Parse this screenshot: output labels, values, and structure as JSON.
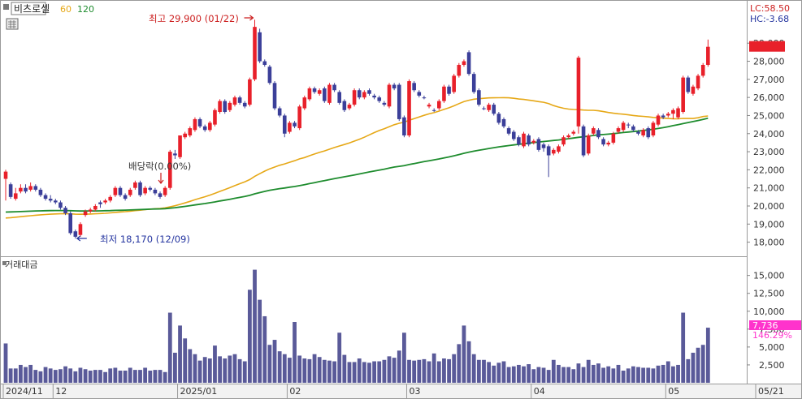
{
  "header": {
    "title": "비츠로셀",
    "ma_labels": [
      "60",
      "120"
    ],
    "ma_colors": [
      "#e6a817",
      "#1e8c2e"
    ],
    "chart_icon": "grid-icon",
    "lc_label": "LC:58.50",
    "hc_label": "HC:-3.68"
  },
  "annotations": {
    "high": "최고 29,900 (01/22)",
    "low": "최저 18,170 (12/09)",
    "dividend": "배당락(0.00%)"
  },
  "price_panel": {
    "current_price": "28,800",
    "change_pct": "3.78%"
  },
  "volume_panel": {
    "title": "거래대금",
    "current_value": "7,736",
    "change_pct": "146.29%"
  },
  "chart_data": {
    "type": "candlestick",
    "title": "비츠로셀",
    "x_ticks": [
      {
        "label": "2024/11",
        "index": 0
      },
      {
        "label": "12",
        "index": 10
      },
      {
        "label": "2025/01",
        "index": 35
      },
      {
        "label": "02",
        "index": 57
      },
      {
        "label": "03",
        "index": 81
      },
      {
        "label": "04",
        "index": 106
      },
      {
        "label": "05",
        "index": 133
      },
      {
        "label": "05/21",
        "index": 152
      }
    ],
    "price_axis": {
      "ylim": [
        17400,
        30400
      ],
      "ticks": [
        18000,
        19000,
        20000,
        21000,
        22000,
        23000,
        24000,
        25000,
        26000,
        27000,
        28000,
        29000
      ]
    },
    "volume_axis": {
      "ylim": [
        0,
        17000
      ],
      "ticks": [
        2500,
        5000,
        7500,
        10000,
        12500,
        15000
      ]
    },
    "price_tick_labels": [
      "18,000",
      "19,000",
      "20,000",
      "21,000",
      "22,000",
      "23,000",
      "24,000",
      "25,000",
      "26,000",
      "27,000",
      "28,000",
      "29,000"
    ],
    "volume_tick_labels": [
      "2,500",
      "5,000",
      "7,500",
      "10,000",
      "12,500",
      "15,000"
    ],
    "up_color": "#e8202a",
    "down_color": "#3b3f99",
    "volume_color": "#5a5a99",
    "ma60_color": "#e6a817",
    "ma120_color": "#1e8c2e",
    "closes": [
      21500,
      20500,
      20700,
      21000,
      20800,
      21100,
      20900,
      20600,
      20400,
      20300,
      20200,
      19900,
      19600,
      18500,
      18300,
      19000,
      19700,
      19800,
      20000,
      20100,
      20300,
      20500,
      21000,
      20600,
      20400,
      20900,
      21300,
      20600,
      21000,
      20900,
      20700,
      20500,
      21000,
      23000,
      22800,
      23900,
      24000,
      24300,
      24800,
      24400,
      24200,
      24600,
      25300,
      25800,
      25200,
      25700,
      26000,
      25700,
      25500,
      27000,
      29900,
      28000,
      27800,
      26800,
      25400,
      25000,
      24000,
      24600,
      24400,
      25500,
      26000,
      26500,
      26300,
      26400,
      25800,
      26700,
      26400,
      25700,
      25300,
      25600,
      26400,
      26000,
      26300,
      26200,
      26000,
      25800,
      25600,
      26700,
      26500,
      24800,
      23900,
      26900,
      26400,
      26100,
      26000,
      25600,
      25300,
      25800,
      26600,
      26200,
      27200,
      27800,
      28000,
      27300,
      26300,
      25600,
      25400,
      25600,
      25100,
      24600,
      24400,
      24000,
      23700,
      23400,
      24000,
      23400,
      23600,
      23100,
      23200,
      22800,
      23100,
      23300,
      23800,
      23900,
      24100,
      24400,
      22800,
      23900,
      24300,
      23800,
      23400,
      23500,
      24000,
      24300,
      24600,
      24500,
      24200,
      24000,
      24200,
      23800,
      24600,
      25000,
      24900,
      25100,
      25300,
      25400,
      27100,
      26300,
      26600,
      27200,
      27800,
      28800
    ],
    "up_days": [
      0,
      3,
      5,
      15,
      17,
      18,
      20,
      21,
      22,
      25,
      26,
      28,
      33,
      35,
      37,
      38,
      41,
      42,
      43,
      45,
      46,
      49,
      50,
      57,
      59,
      60,
      61,
      63,
      65,
      69,
      70,
      72,
      77,
      81,
      85,
      88,
      90,
      91,
      92,
      97,
      104,
      106,
      110,
      111,
      112,
      113,
      114,
      115,
      117,
      118,
      122,
      123,
      124,
      128,
      130,
      131,
      133,
      136,
      138,
      139,
      140,
      141
    ],
    "opens": [
      21900,
      21200,
      20400,
      20800,
      21000,
      20900,
      21100,
      20900,
      20600,
      20400,
      20300,
      20200,
      19900,
      19600,
      18600,
      18400,
      19500,
      19700,
      19800,
      20200,
      20200,
      20300,
      20600,
      21000,
      20600,
      20600,
      21000,
      21300,
      20700,
      21000,
      20900,
      20700,
      20600,
      21000,
      22900,
      22700,
      23800,
      23900,
      24200,
      24800,
      24400,
      24200,
      24500,
      25200,
      25800,
      25300,
      25600,
      26000,
      25700,
      25600,
      27000,
      29600,
      28000,
      27700,
      26800,
      25400,
      25000,
      24100,
      24600,
      24300,
      25400,
      25900,
      26500,
      26200,
      26500,
      25700,
      26700,
      26300,
      25800,
      25400,
      25600,
      26400,
      26000,
      26400,
      26100,
      26000,
      25700,
      25500,
      26700,
      26700,
      24900,
      23900,
      26800,
      26300,
      26000,
      25500,
      25300,
      25400,
      25800,
      26600,
      26300,
      27200,
      27800,
      28500,
      27300,
      26400,
      25400,
      25300,
      25600,
      25100,
      24800,
      24300,
      24100,
      23800,
      23300,
      23900,
      23500,
      23700,
      23400,
      23300,
      22900,
      23000,
      23400,
      23800,
      24000,
      28200,
      24400,
      22900,
      24000,
      24200,
      23700,
      23400,
      23500,
      24100,
      24200,
      24500,
      24400,
      24100,
      23900,
      24300,
      23900,
      24500,
      25000,
      25000,
      25100,
      24900,
      25200,
      27100,
      26200,
      26500,
      27200,
      27800
    ],
    "highs": [
      22000,
      21300,
      21000,
      21200,
      21200,
      21300,
      21200,
      21000,
      20700,
      20600,
      20400,
      20300,
      20000,
      19700,
      18700,
      19100,
      19800,
      19900,
      20100,
      20300,
      20400,
      20600,
      21100,
      21100,
      20700,
      21000,
      21400,
      21400,
      21100,
      21100,
      21000,
      20800,
      21100,
      23100,
      23100,
      23100,
      24100,
      24400,
      24900,
      24900,
      24500,
      24700,
      25400,
      25900,
      25900,
      25800,
      26100,
      26100,
      25800,
      27100,
      30300,
      29800,
      28100,
      27800,
      26900,
      25500,
      25100,
      24700,
      24700,
      25600,
      26100,
      26600,
      26600,
      26500,
      26600,
      26800,
      26800,
      26400,
      25900,
      25700,
      26500,
      26500,
      26400,
      26500,
      26200,
      26100,
      25800,
      26800,
      26800,
      26800,
      25000,
      27000,
      26900,
      26400,
      26100,
      25700,
      25400,
      25900,
      26700,
      26700,
      27300,
      27900,
      28100,
      28600,
      27400,
      26500,
      25500,
      25700,
      25700,
      25200,
      24900,
      24400,
      24200,
      23900,
      24100,
      24000,
      23700,
      23800,
      23500,
      23400,
      23200,
      23400,
      23900,
      24000,
      24200,
      28300,
      24500,
      24000,
      24400,
      24300,
      23800,
      23600,
      24100,
      24400,
      24700,
      24600,
      24500,
      24200,
      24300,
      24400,
      24700,
      25100,
      25100,
      25200,
      25400,
      25500,
      27200,
      27200,
      26700,
      27300,
      27900,
      29200
    ],
    "lows": [
      20300,
      20400,
      20300,
      20700,
      20700,
      20800,
      20800,
      20500,
      20300,
      20200,
      20100,
      19800,
      19500,
      18400,
      18200,
      18300,
      19400,
      19600,
      19700,
      19900,
      20100,
      20200,
      20500,
      20500,
      20300,
      20500,
      20900,
      20500,
      20600,
      20800,
      20600,
      20400,
      20500,
      20900,
      22600,
      22600,
      23700,
      23800,
      24100,
      24300,
      24100,
      24100,
      24400,
      25100,
      25100,
      25200,
      25500,
      25600,
      25400,
      25500,
      26900,
      27900,
      27700,
      26700,
      25300,
      24900,
      23800,
      24000,
      24300,
      24200,
      25300,
      25800,
      26200,
      26100,
      25700,
      25600,
      26300,
      25600,
      25200,
      25300,
      25500,
      25900,
      25900,
      26100,
      25900,
      25700,
      25500,
      25400,
      26400,
      24700,
      23800,
      23800,
      26300,
      26000,
      25900,
      25400,
      25200,
      25300,
      25700,
      26100,
      26200,
      27100,
      27700,
      27200,
      26200,
      25500,
      25300,
      25200,
      25000,
      24500,
      24300,
      23900,
      23600,
      23300,
      23200,
      23300,
      23400,
      23000,
      23000,
      21600,
      22800,
      22900,
      23300,
      23700,
      23900,
      24000,
      22700,
      22800,
      23900,
      23700,
      23300,
      23300,
      23400,
      24000,
      24100,
      24300,
      24100,
      23900,
      23800,
      23700,
      23800,
      24400,
      24800,
      24900,
      24800,
      24800,
      25100,
      26200,
      26100,
      26400,
      27100,
      27700
    ],
    "volumes": [
      5500,
      2000,
      2000,
      2500,
      2200,
      2500,
      1800,
      1600,
      2200,
      2000,
      1800,
      1900,
      2300,
      2000,
      1600,
      2100,
      1900,
      1700,
      1800,
      1800,
      1500,
      2000,
      2100,
      1700,
      1700,
      2100,
      1800,
      1800,
      2100,
      1700,
      1800,
      1800,
      1500,
      9800,
      4200,
      8000,
      6200,
      4700,
      4000,
      3100,
      3600,
      3400,
      5200,
      3700,
      3400,
      3800,
      4000,
      3300,
      3000,
      13000,
      15800,
      11600,
      9300,
      5300,
      6000,
      4400,
      4000,
      3500,
      8500,
      3800,
      3400,
      3300,
      4000,
      3600,
      3200,
      3100,
      3000,
      7000,
      3900,
      2900,
      2900,
      3400,
      2900,
      2800,
      3000,
      3000,
      3200,
      3700,
      3500,
      4500,
      7000,
      3200,
      3100,
      3200,
      3300,
      3000,
      4100,
      3000,
      3400,
      3300,
      4000,
      5400,
      8000,
      5800,
      4000,
      3200,
      3200,
      2900,
      2400,
      2800,
      3000,
      2200,
      2300,
      2500,
      2300,
      2600,
      1900,
      2200,
      2100,
      1800,
      3200,
      2500,
      2200,
      2200,
      1900,
      2700,
      2200,
      3200,
      2500,
      2700,
      2100,
      2300,
      2000,
      2500,
      1700,
      2000,
      2300,
      2200,
      2100,
      2100,
      2000,
      2400,
      2500,
      3000,
      2300,
      2500,
      9800,
      3300,
      4200,
      4900,
      5300,
      7700
    ]
  }
}
